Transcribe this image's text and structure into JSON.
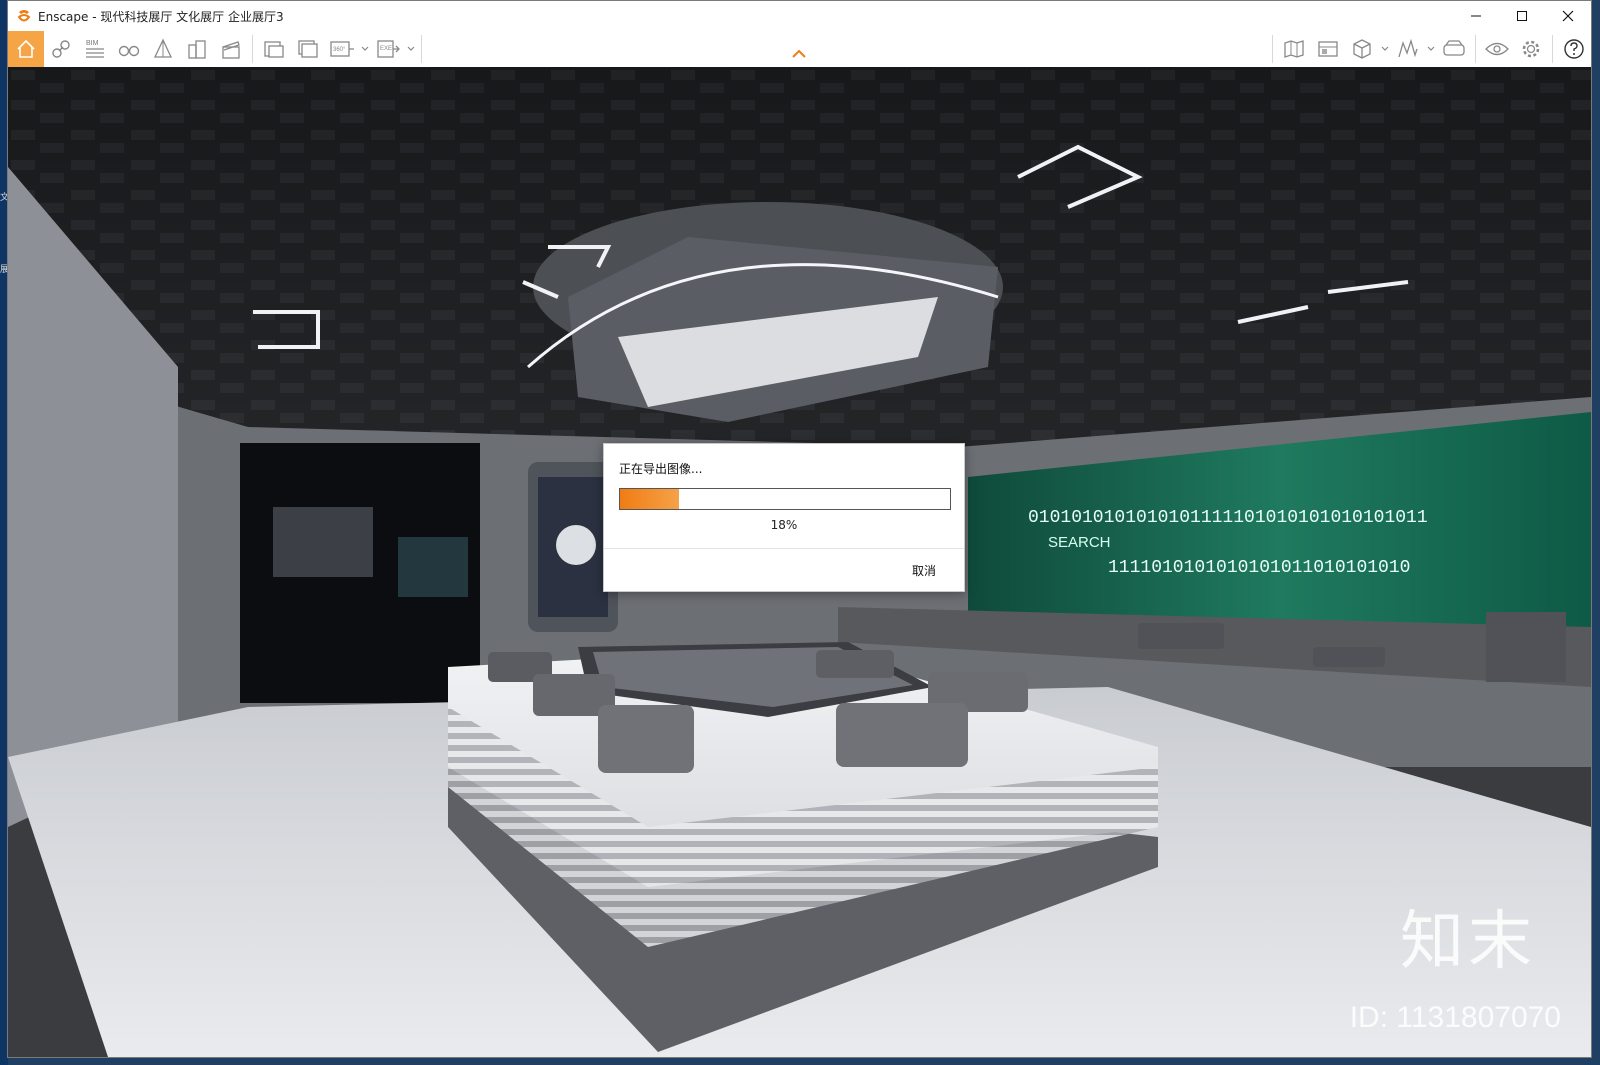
{
  "window": {
    "title": "Enscape - 现代科技展厅 文化展厅 企业展厅3",
    "controls": [
      "minimize",
      "maximize",
      "close"
    ]
  },
  "toolbar": {
    "left_icons": [
      "home-icon",
      "link-icon",
      "bim-icon",
      "binoculars-icon",
      "perspective-icon",
      "buildings-icon",
      "clapper-icon",
      "screenshot-icon",
      "batch-render-icon",
      "panorama-360-icon",
      "export-exe-icon"
    ],
    "right_icons": [
      "map-icon",
      "asset-library-icon",
      "material-cube-icon",
      "sketch-icon",
      "vr-headset-icon",
      "visual-settings-icon",
      "settings-gear-icon",
      "help-icon"
    ],
    "bim_label": "BIM",
    "pano_label": "360°",
    "exe_label": "EXE"
  },
  "dialog": {
    "title": "正在导出图像...",
    "progress_percent": 18,
    "progress_label": "18%",
    "cancel_label": "取消"
  },
  "scene": {
    "wall_text_search": "SEARCH",
    "wall_binary_row1": "0101010101010101111101010101010101011",
    "wall_binary_row2": "1111010101010101011010101010"
  },
  "watermark": {
    "logo_text": "知末",
    "id_text": "ID: 1131807070"
  },
  "colors": {
    "accent_orange": "#f07c14",
    "home_bg": "#f5a446",
    "screen_green": "#1f7a5e"
  }
}
